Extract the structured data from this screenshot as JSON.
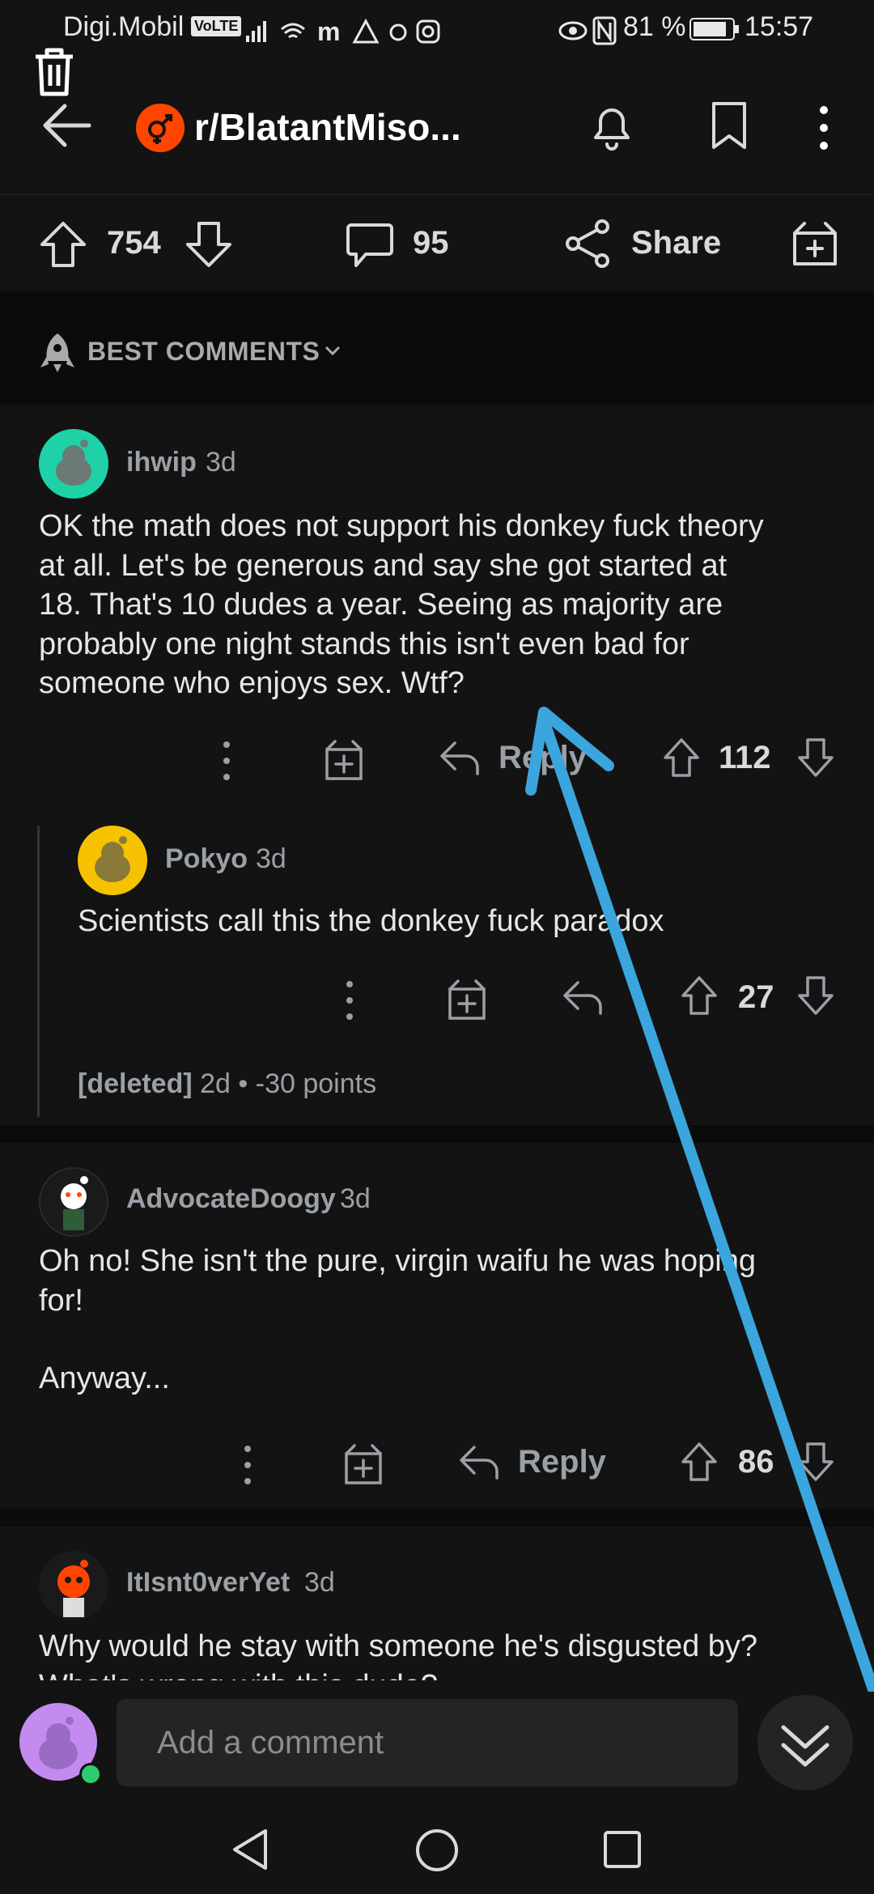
{
  "status_bar": {
    "carrier": "Digi.Mobil",
    "volte": "VoLTE",
    "battery": "81 %",
    "time": "15:57"
  },
  "header": {
    "subreddit": "r/BlatantMiso..."
  },
  "post_actions": {
    "upvotes": "754",
    "comments": "95",
    "share": "Share"
  },
  "sort": {
    "label": "BEST COMMENTS"
  },
  "comments": [
    {
      "user": "ihwip",
      "age": "3d",
      "lines": [
        "OK the math does not support his donkey fuck theory",
        "at all. Let's be generous and say she got started at",
        "18. That's 10 dudes a year. Seeing as majority are",
        "probably one night stands this isn't even bad for",
        "someone who enjoys sex. Wtf?"
      ],
      "reply": "Reply",
      "votes": "112"
    },
    {
      "user": "Pokyo",
      "age": "3d",
      "lines": [
        "Scientists call this the donkey fuck paradox"
      ],
      "votes": "27"
    },
    {
      "user": "AdvocateDoogy",
      "age": "3d",
      "lines": [
        "Oh no! She isn't the pure, virgin waifu he was hoping",
        "for!",
        "",
        "Anyway..."
      ],
      "reply": "Reply",
      "votes": "86"
    },
    {
      "user": "ItIsnt0verYet",
      "age": "3d",
      "lines": [
        "Why would he stay with someone he's disgusted by?",
        "What's wrong with this dude?"
      ]
    }
  ],
  "deleted": {
    "user": "[deleted]",
    "age": "2d",
    "sep": "•",
    "points": "-30 points"
  },
  "composer": {
    "placeholder": "Add a comment"
  },
  "colors": {
    "subreddit_icon": "#ff4500",
    "arrow_annotation": "#3aa6dd",
    "online_dot": "#2ecc71"
  }
}
